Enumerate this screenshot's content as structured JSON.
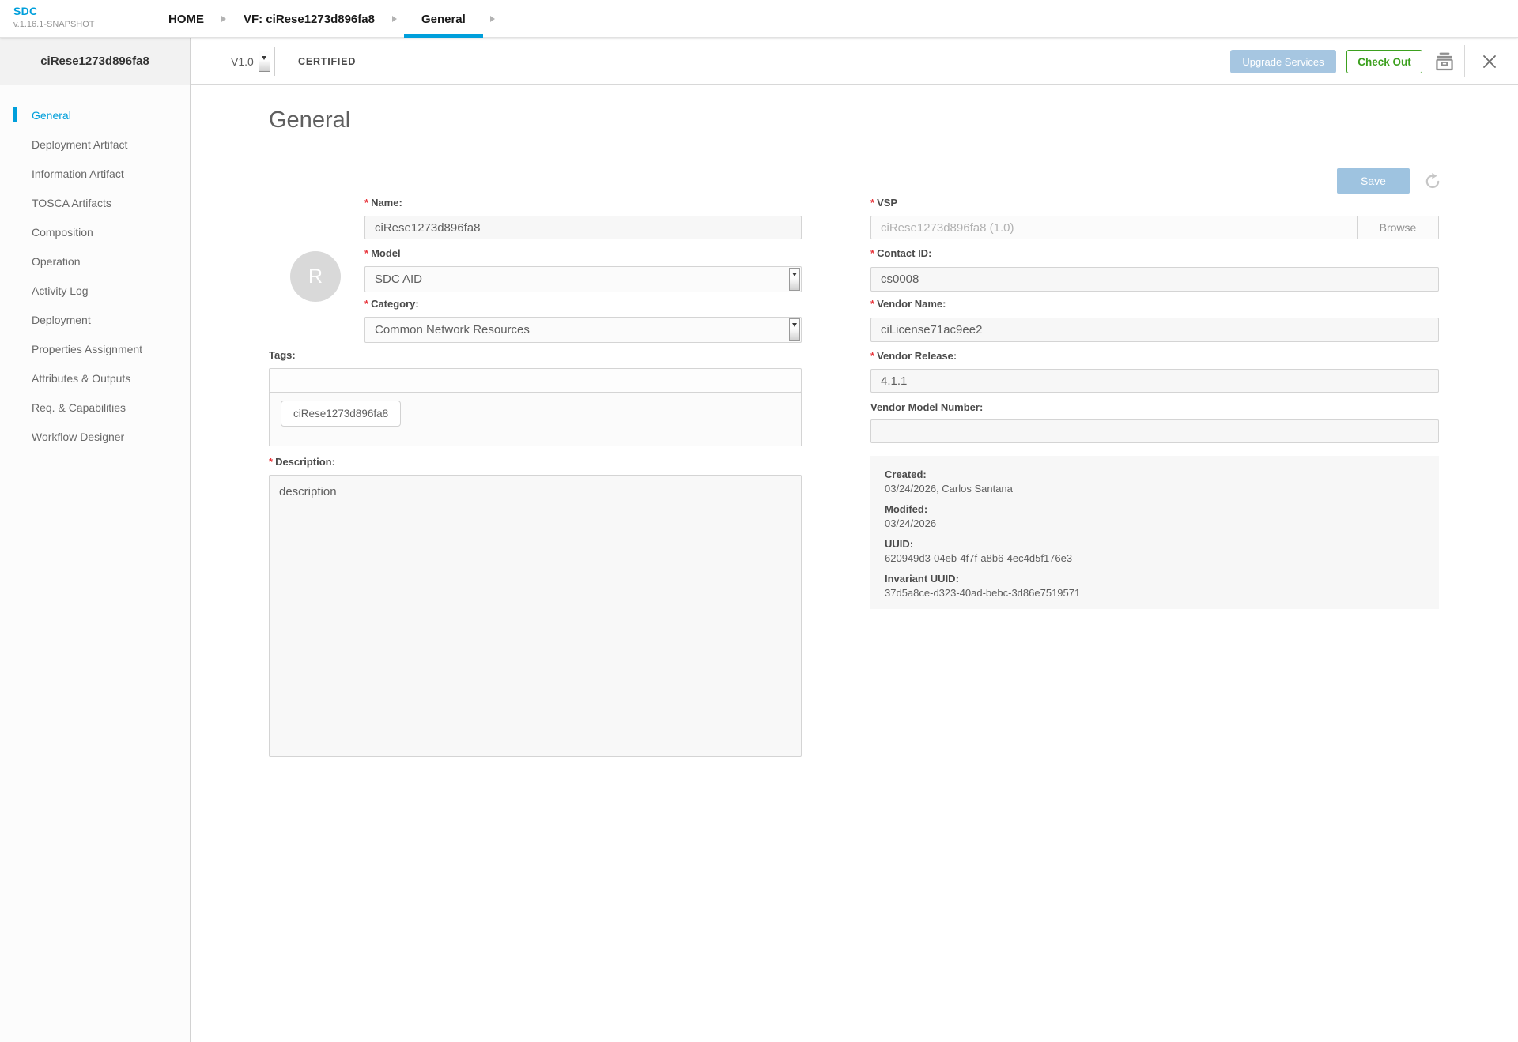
{
  "topnav": {
    "logo": "SDC",
    "version": "v.1.16.1-SNAPSHOT",
    "breadcrumbs": [
      {
        "label": "HOME"
      },
      {
        "label": "VF: ciRese1273d896fa8"
      },
      {
        "label": "General"
      }
    ]
  },
  "header": {
    "title": "ciRese1273d896fa8",
    "version_selected": "V1.0",
    "lifecycle_state": "CERTIFIED",
    "upgrade_services_label": "Upgrade Services",
    "check_out_label": "Check Out"
  },
  "sidebar": {
    "items": [
      {
        "label": "General"
      },
      {
        "label": "Deployment Artifact"
      },
      {
        "label": "Information Artifact"
      },
      {
        "label": "TOSCA Artifacts"
      },
      {
        "label": "Composition"
      },
      {
        "label": "Operation"
      },
      {
        "label": "Activity Log"
      },
      {
        "label": "Deployment"
      },
      {
        "label": "Properties Assignment"
      },
      {
        "label": "Attributes & Outputs"
      },
      {
        "label": "Req. & Capabilities"
      },
      {
        "label": "Workflow Designer"
      }
    ]
  },
  "main": {
    "page_title": "General",
    "save_label": "Save",
    "required_marker": "*",
    "avatar_letter": "R",
    "fields": {
      "name": {
        "label": "Name:",
        "value": "ciRese1273d896fa8"
      },
      "model": {
        "label": "Model",
        "value": "SDC AID"
      },
      "category": {
        "label": "Category:",
        "value": "Common Network Resources"
      },
      "tags": {
        "label": "Tags:",
        "value": "",
        "chip": "ciRese1273d896fa8"
      },
      "description": {
        "label": "Description:",
        "value": "description"
      },
      "vsp": {
        "label": "VSP",
        "value": "ciRese1273d896fa8 (1.0)",
        "browse_label": "Browse"
      },
      "contact_id": {
        "label": "Contact ID:",
        "value": "cs0008"
      },
      "vendor_name": {
        "label": "Vendor Name:",
        "value": "ciLicense71ac9ee2"
      },
      "vendor_release": {
        "label": "Vendor Release:",
        "value": "4.1.1"
      },
      "vendor_model_number": {
        "label": "Vendor Model Number:",
        "value": ""
      }
    },
    "meta": [
      {
        "label": "Created:",
        "value": "03/24/2026, Carlos Santana"
      },
      {
        "label": "Modifed:",
        "value": "03/24/2026"
      },
      {
        "label": "UUID:",
        "value": "620949d3-04eb-4f7f-a8b6-4ec4d5f176e3"
      },
      {
        "label": "Invariant UUID:",
        "value": "37d5a8ce-d323-40ad-bebc-3d86e7519571"
      }
    ]
  },
  "colors": {
    "accent_blue": "#009fdb",
    "checkout_green": "#3ca01e",
    "save_blue": "#9ec3e0",
    "required_red": "#e8363d"
  }
}
